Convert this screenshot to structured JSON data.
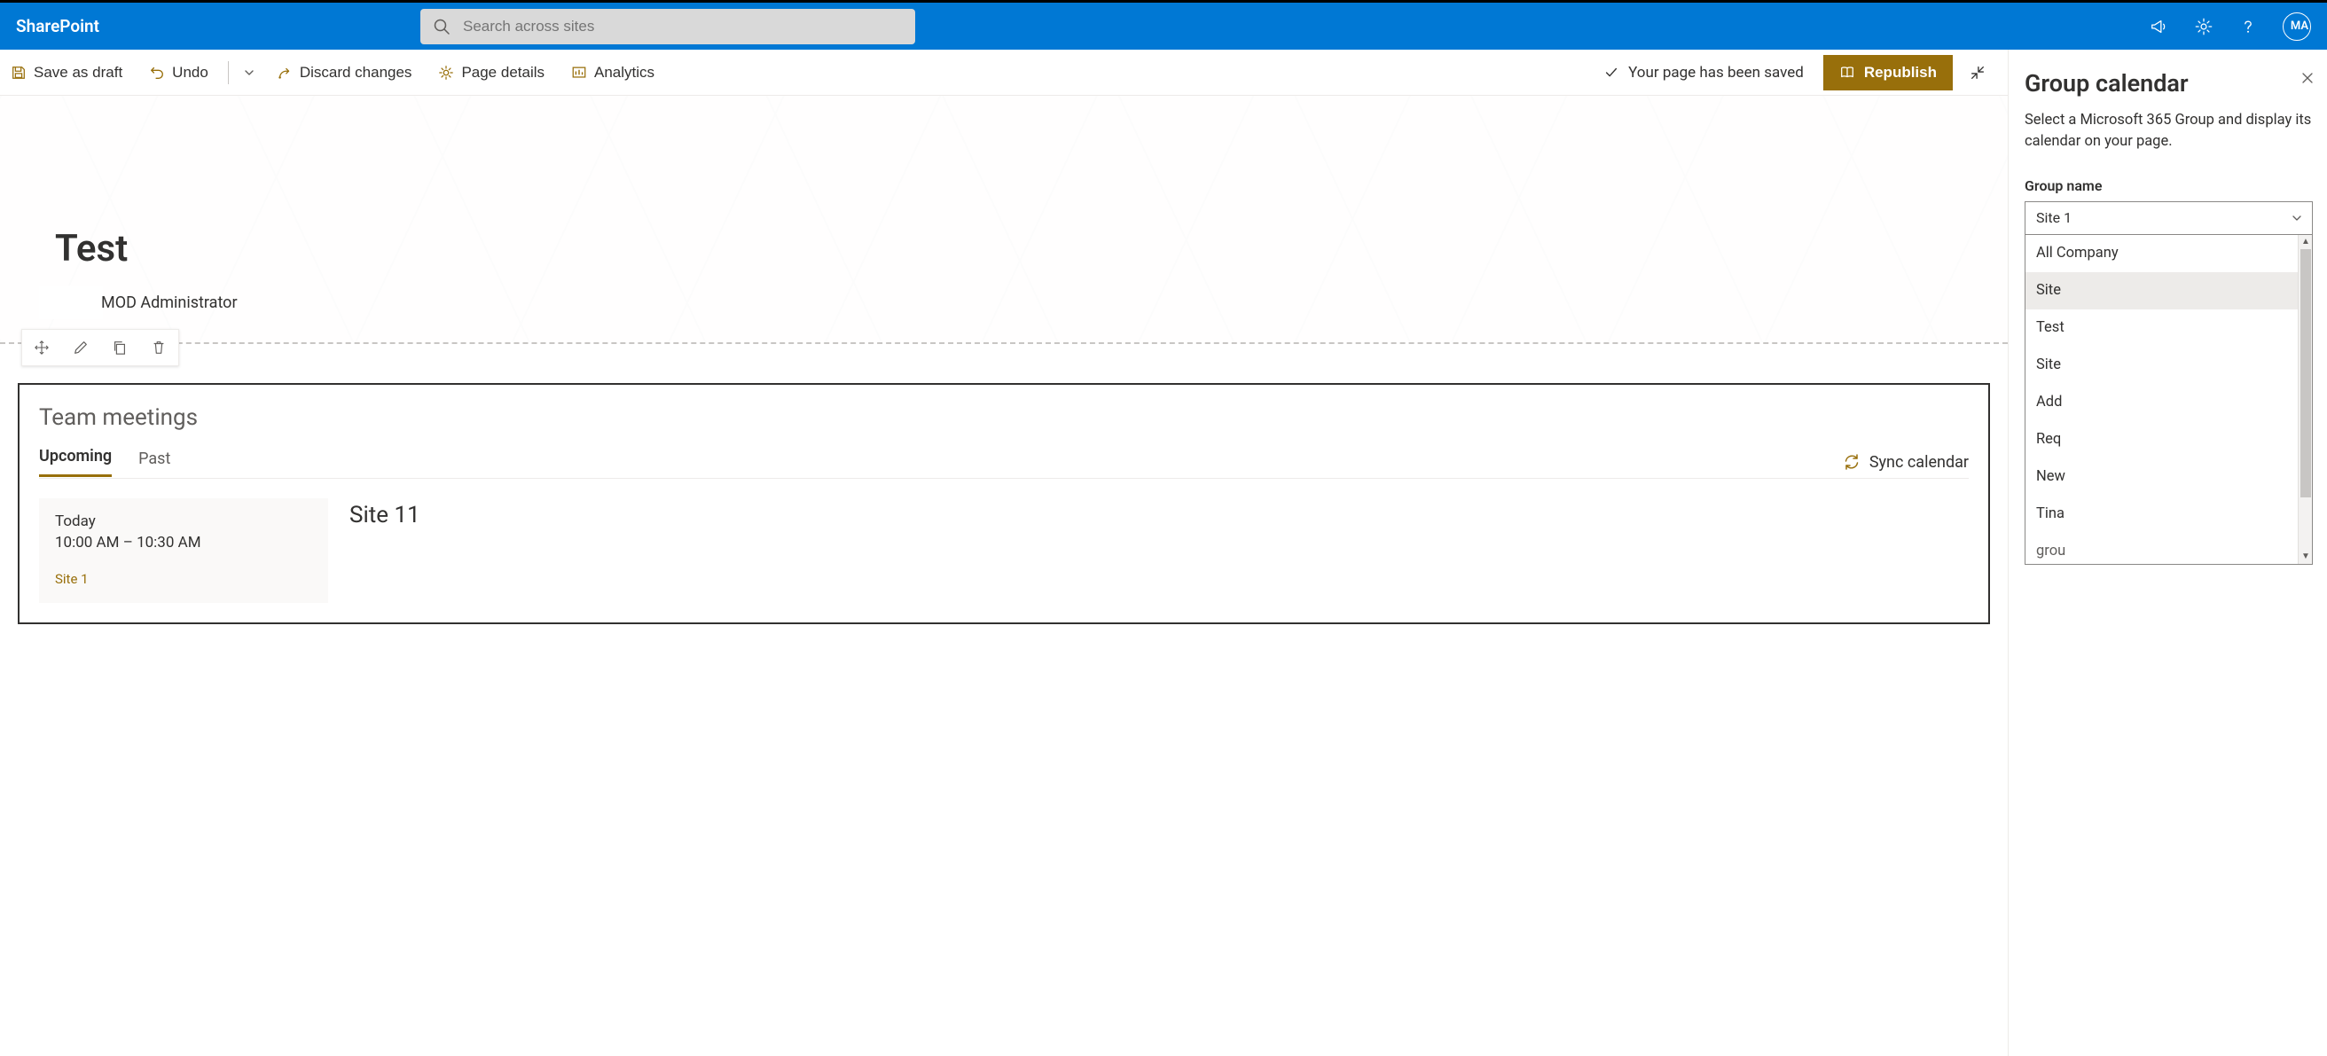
{
  "app_bar": {
    "brand": "SharePoint",
    "search_placeholder": "Search across sites",
    "avatar_initials": "MA"
  },
  "cmdbar": {
    "save_draft": "Save as draft",
    "undo": "Undo",
    "discard": "Discard changes",
    "page_details": "Page details",
    "analytics": "Analytics",
    "status": "Your page has been saved",
    "republish": "Republish"
  },
  "hero": {
    "title": "Test",
    "author": "MOD Administrator"
  },
  "webpart": {
    "title": "Team meetings",
    "tabs": {
      "upcoming": "Upcoming",
      "past": "Past"
    },
    "sync": "Sync calendar",
    "event": {
      "day": "Today",
      "time": "10:00 AM – 10:30 AM",
      "site": "Site 1",
      "title": "Site 11"
    }
  },
  "panel": {
    "heading": "Group calendar",
    "description": "Select a Microsoft 365 Group and display its calendar on your page.",
    "field_label": "Group name",
    "selected": "Site 1",
    "options": [
      "All Company",
      "Site",
      "Test",
      "Site",
      "Add",
      "Req",
      "New",
      "Tina",
      "grou"
    ]
  },
  "colors": {
    "brand_blue": "#0078D4",
    "accent": "#986F0B"
  }
}
